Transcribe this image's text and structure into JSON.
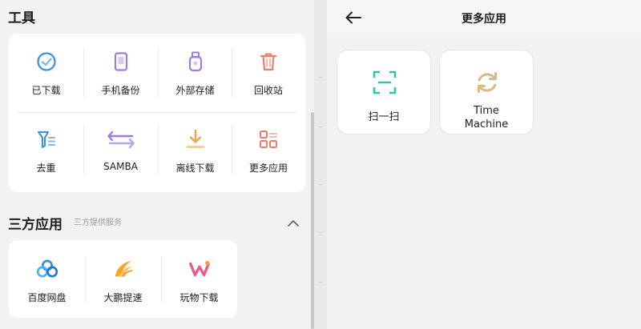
{
  "tools": {
    "title": "工具",
    "items": [
      {
        "label": "已下载",
        "icon": "downloaded-icon"
      },
      {
        "label": "手机备份",
        "icon": "phone-backup-icon"
      },
      {
        "label": "外部存储",
        "icon": "usb-storage-icon"
      },
      {
        "label": "回收站",
        "icon": "trash-icon"
      },
      {
        "label": "去重",
        "icon": "dedupe-icon"
      },
      {
        "label": "SAMBA",
        "icon": "transfer-arrows-icon"
      },
      {
        "label": "离线下载",
        "icon": "offline-download-icon"
      },
      {
        "label": "更多应用",
        "icon": "more-apps-icon"
      }
    ]
  },
  "third_party": {
    "title": "三方应用",
    "subtitle": "三方提供服务",
    "items": [
      {
        "label": "百度网盘",
        "icon": "baidu-netdisk-icon"
      },
      {
        "label": "大鹏提速",
        "icon": "dapeng-speedup-icon"
      },
      {
        "label": "玩物下载",
        "icon": "wanwu-download-icon"
      }
    ]
  },
  "more_apps": {
    "title": "更多应用",
    "apps": [
      {
        "label": "扫一扫",
        "icon": "scan-icon"
      },
      {
        "label_line1": "Time",
        "label_line2": "Machine",
        "icon": "time-machine-icon"
      }
    ]
  },
  "colors": {
    "accent_blue": "#3a8ee6",
    "accent_purple": "#9d7be5",
    "accent_orange": "#f0a43c",
    "accent_red": "#ef7b6a",
    "accent_green": "#2fc7a0",
    "accent_tan": "#d9b88a"
  }
}
